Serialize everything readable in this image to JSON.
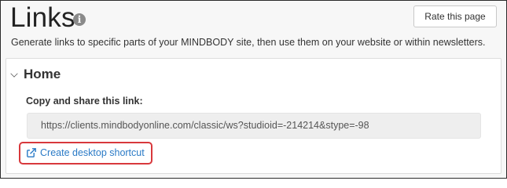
{
  "header": {
    "title": "Links",
    "info_icon": "info-icon",
    "rate_button_label": "Rate this page"
  },
  "subtitle": "Generate links to specific parts of your MINDBODY site, then use them on your website or within newsletters.",
  "panel": {
    "title": "Home",
    "toggle_icon": "chevron-down-icon",
    "copy_label": "Copy and share this link:",
    "link_value": "https://clients.mindbodyonline.com/classic/ws?studioid=-214214&stype=-98",
    "shortcut_label": "Create desktop shortcut",
    "shortcut_icon": "external-link-icon"
  },
  "colors": {
    "link": "#2a7ac6",
    "highlight": "#d8383c",
    "field_background": "#eeeeee"
  }
}
